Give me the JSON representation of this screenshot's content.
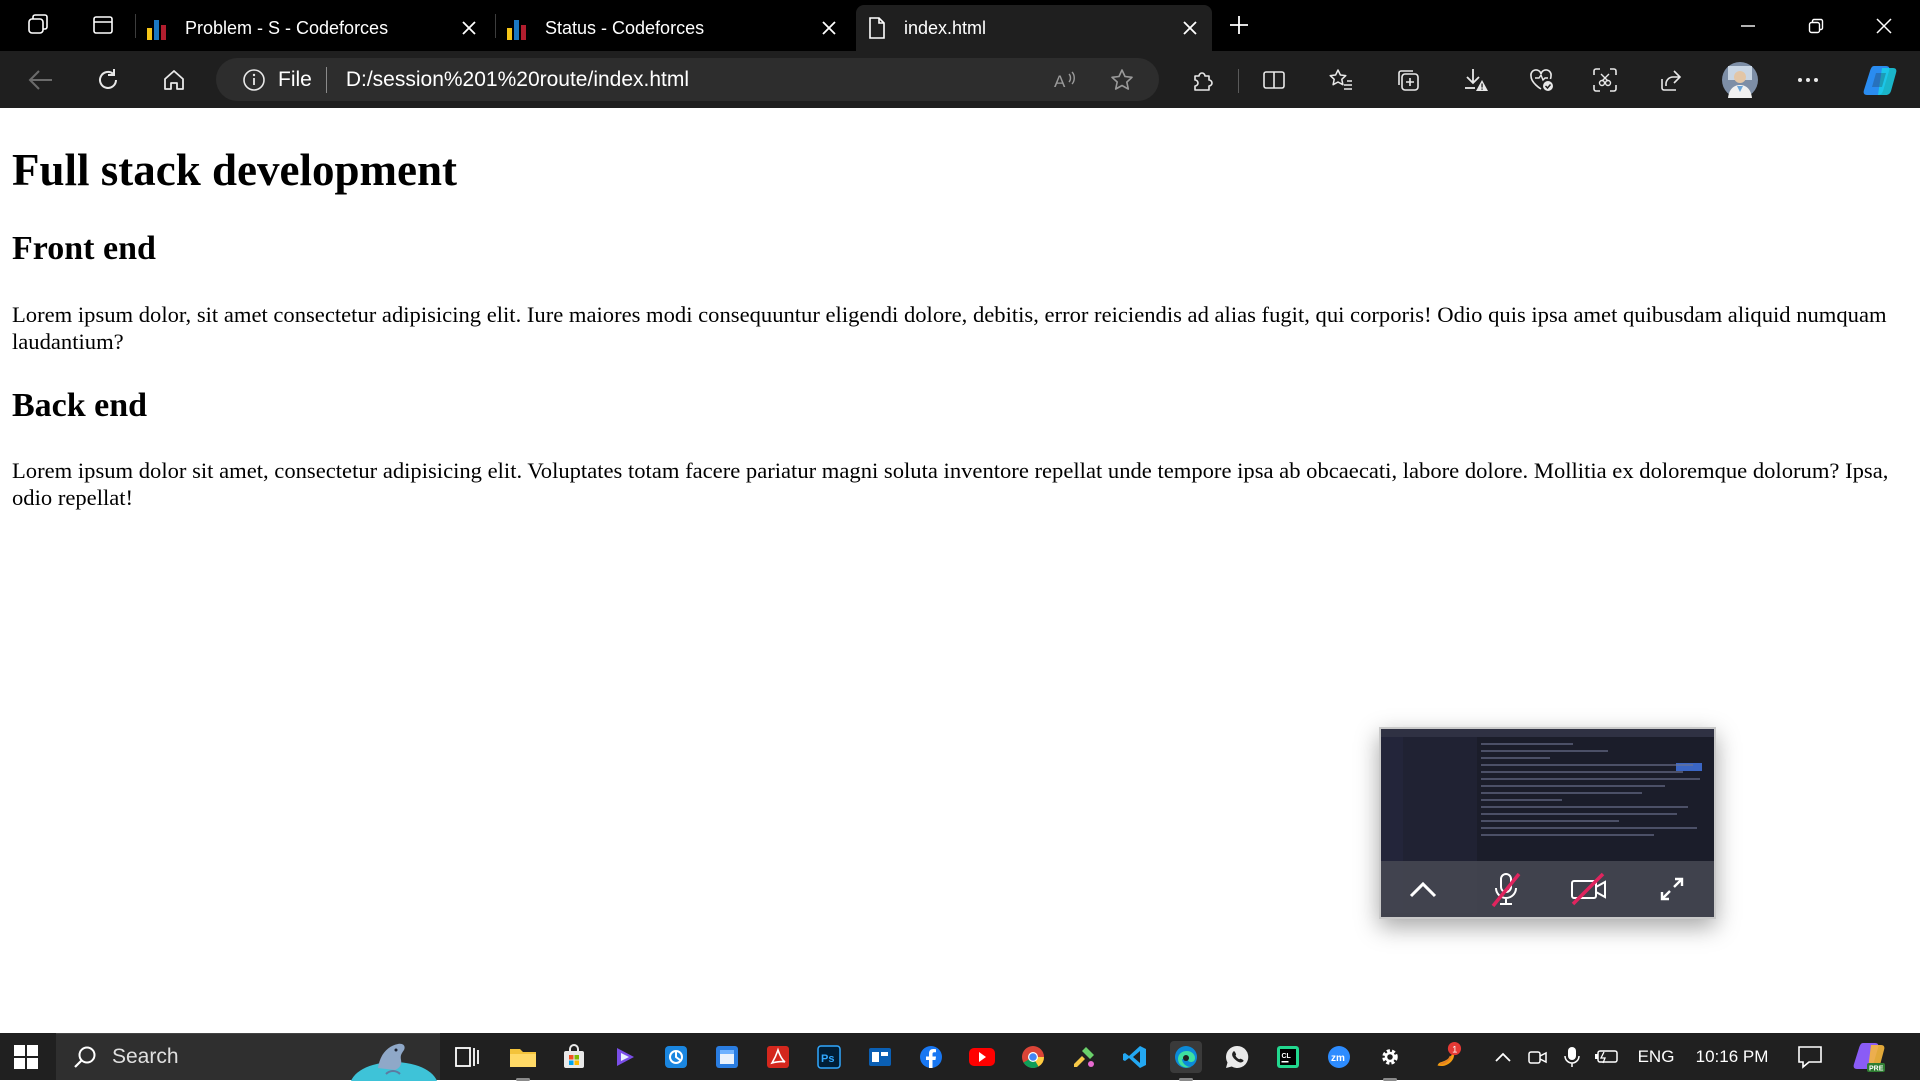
{
  "browser": {
    "tabs": [
      {
        "title": "Problem - S - Codeforces",
        "favicon": "codeforces-icon",
        "active": false
      },
      {
        "title": "Status - Codeforces",
        "favicon": "codeforces-icon",
        "active": false
      },
      {
        "title": "index.html",
        "favicon": "file-icon",
        "active": true
      }
    ],
    "address": {
      "scheme_label": "File",
      "url": "D:/session%201%20route/index.html"
    },
    "accent": "#1f1f1f"
  },
  "page": {
    "h1": "Full stack development",
    "sections": [
      {
        "heading": "Front end",
        "text": "Lorem ipsum dolor, sit amet consectetur adipisicing elit. Iure maiores modi consequuntur eligendi dolore, debitis, error reiciendis ad alias fugit, qui corporis! Odio quis ipsa amet quibusdam aliquid numquam laudantium?"
      },
      {
        "heading": "Back end",
        "text": "Lorem ipsum dolor sit amet, consectetur adipisicing elit. Voluptates totam facere pariatur magni soluta inventore repellat unde tempore ipsa ab obcaecati, labore dolore. Mollitia ex doloremque dolorum? Ipsa, odio repellat!"
      }
    ]
  },
  "taskbar": {
    "search_label": "Search",
    "apps": [
      "task-view",
      "file-explorer",
      "microsoft-store",
      "media-player",
      "app-icon",
      "app-icon",
      "acrobat",
      "photoshop",
      "app-icon",
      "facebook",
      "youtube",
      "chrome",
      "app-icon",
      "vscode",
      "edge",
      "whatsapp",
      "clion",
      "zoom",
      "settings",
      "app-icon"
    ],
    "notification_badge": "1",
    "language": "ENG",
    "time": "10:16 PM"
  }
}
